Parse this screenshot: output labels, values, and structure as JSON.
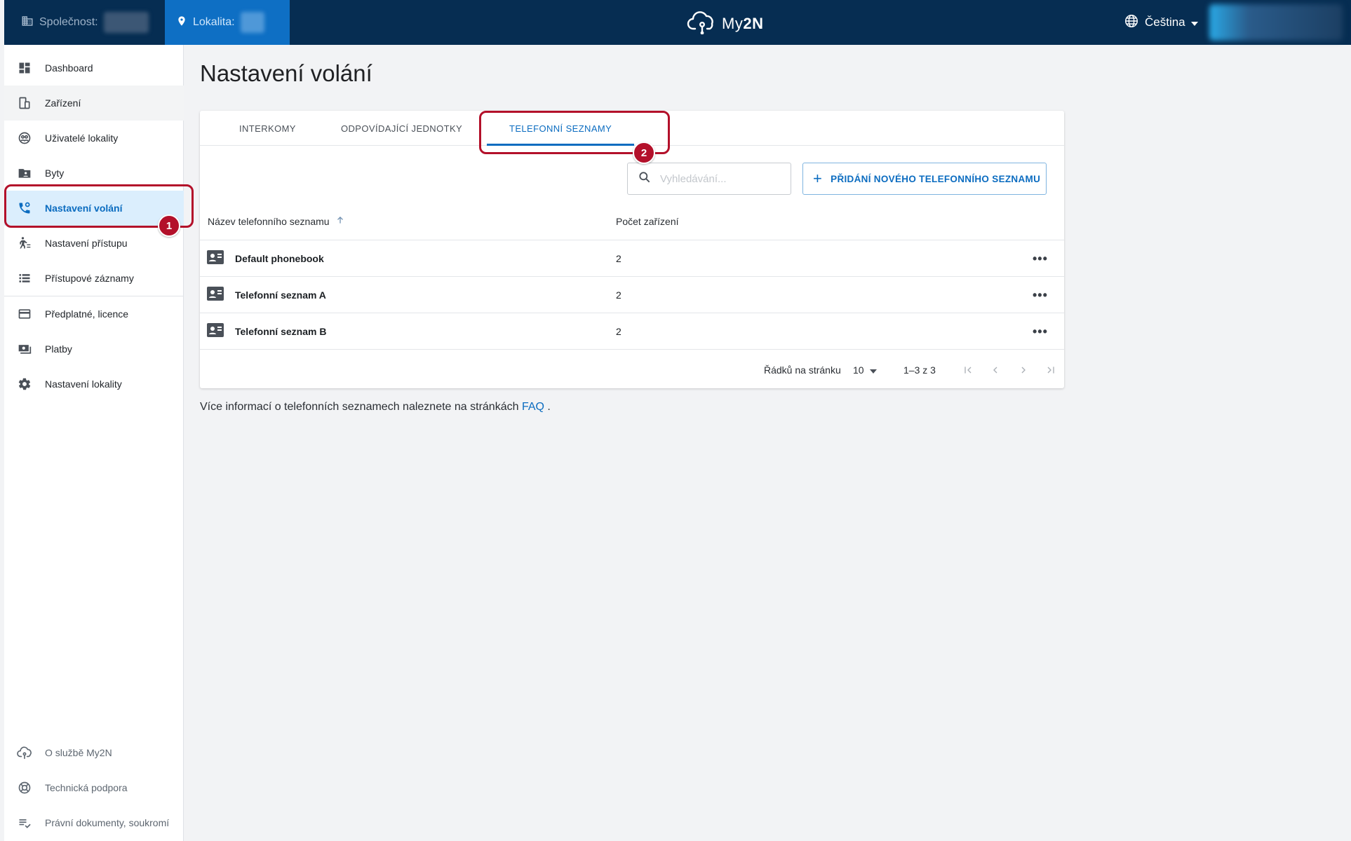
{
  "topbar": {
    "company_label": "Společnost:",
    "location_label": "Lokalita:",
    "logo_text_light": "My",
    "logo_text_bold": "2N",
    "language": "Čeština"
  },
  "sidebar": {
    "items": [
      {
        "label": "Dashboard",
        "icon": "dashboard-icon"
      },
      {
        "label": "Zařízení",
        "icon": "devices-icon"
      },
      {
        "label": "Uživatelé lokality",
        "icon": "users-icon"
      },
      {
        "label": "Byty",
        "icon": "apartments-icon"
      },
      {
        "label": "Nastavení volání",
        "icon": "call-settings-icon"
      },
      {
        "label": "Nastavení přístupu",
        "icon": "access-settings-icon"
      },
      {
        "label": "Přístupové záznamy",
        "icon": "access-log-icon"
      },
      {
        "label": "Předplatné, licence",
        "icon": "subscription-icon"
      },
      {
        "label": "Platby",
        "icon": "payments-icon"
      },
      {
        "label": "Nastavení lokality",
        "icon": "gear-icon"
      }
    ],
    "footer": [
      {
        "label": "O službě My2N",
        "icon": "cloud-icon"
      },
      {
        "label": "Technická podpora",
        "icon": "support-icon"
      },
      {
        "label": "Právní dokumenty, soukromí",
        "icon": "legal-icon"
      }
    ]
  },
  "main": {
    "title": "Nastavení volání",
    "tabs": [
      {
        "label": "INTERKOMY"
      },
      {
        "label": "ODPOVÍDAJÍCÍ JEDNOTKY"
      },
      {
        "label": "TELEFONNÍ SEZNAMY"
      }
    ],
    "search_placeholder": "Vyhledávání...",
    "add_button": "PŘIDÁNÍ NOVÉHO TELEFONNÍHO SEZNAMU",
    "table": {
      "columns": [
        "Název telefonního seznamu",
        "Počet zařízení"
      ],
      "rows": [
        {
          "name": "Default phonebook",
          "count": "2"
        },
        {
          "name": "Telefonní seznam A",
          "count": "2"
        },
        {
          "name": "Telefonní seznam B",
          "count": "2"
        }
      ]
    },
    "pagination": {
      "rows_per_page_label": "Řádků na stránku",
      "rows_per_page": "10",
      "range": "1–3 z 3"
    },
    "info_text": "Více informací o telefonních seznamech naleznete na stránkách",
    "info_link": "FAQ",
    "info_end": "."
  },
  "annotations": [
    "1",
    "2"
  ],
  "colors": {
    "topbar": "#062d52",
    "accent": "#0b6cc0",
    "annotation": "#b3102a",
    "active_nav_bg": "#dbeefd"
  }
}
